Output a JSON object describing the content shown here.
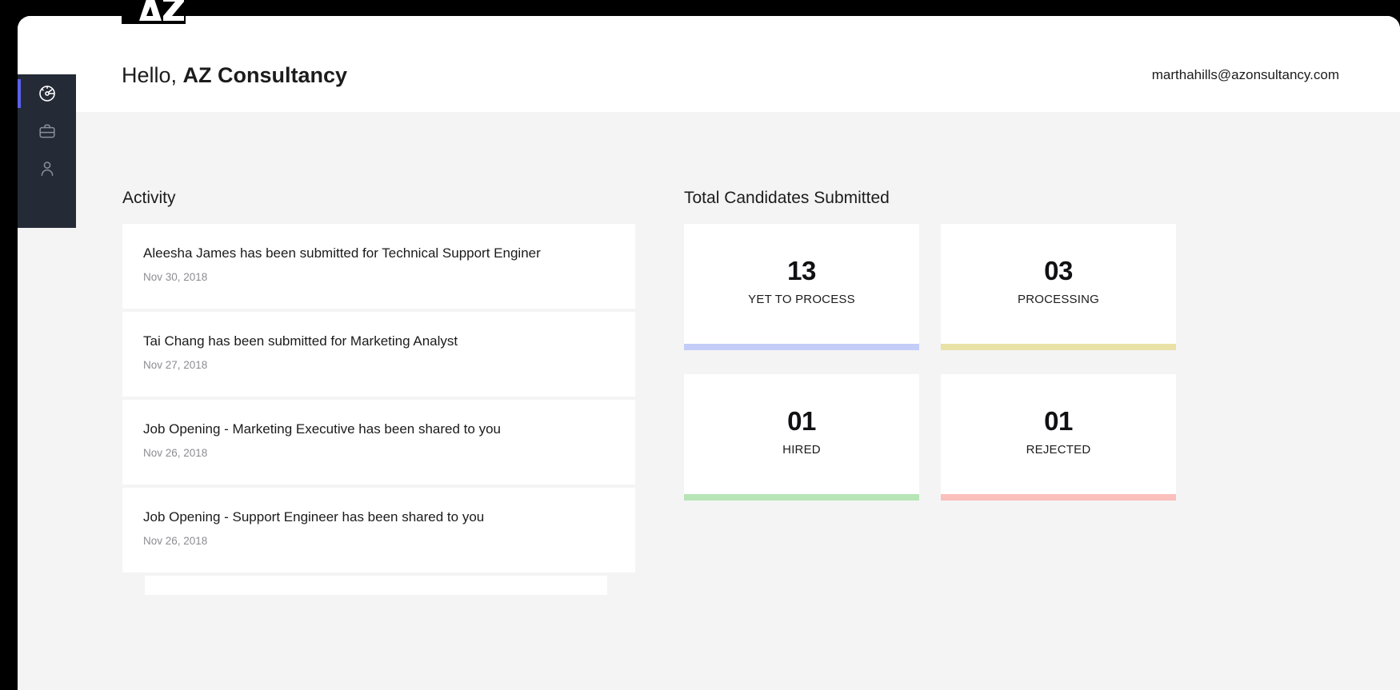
{
  "brand": {
    "logo_text": "AZ",
    "logo_icon": "az-logo-icon"
  },
  "sidebar": {
    "items": [
      {
        "icon": "dashboard-speedometer-icon",
        "name": "dashboard",
        "active": true
      },
      {
        "icon": "briefcase-icon",
        "name": "jobs",
        "active": false
      },
      {
        "icon": "user-person-icon",
        "name": "candidates",
        "active": false
      }
    ],
    "background_color": "#252a37",
    "active_indicator_color": "#5c62ec"
  },
  "header": {
    "greeting_prefix": "Hello, ",
    "company_name": "AZ Consultancy",
    "user_email": "marthahills@azonsultancy.com"
  },
  "activity": {
    "title": "Activity",
    "items": [
      {
        "text": "Aleesha James has been submitted for Technical Support Enginer",
        "date": "Nov 30, 2018"
      },
      {
        "text": "Tai Chang has been submitted for Marketing Analyst",
        "date": "Nov 27, 2018"
      },
      {
        "text": "Job Opening - Marketing Executive has been shared to you",
        "date": "Nov 26, 2018"
      },
      {
        "text": "Job Opening - Support Engineer has been shared to you",
        "date": "Nov 26, 2018"
      }
    ]
  },
  "stats": {
    "title": "Total Candidates Submitted",
    "cards": [
      {
        "value": "13",
        "label": "YET TO PROCESS",
        "bar_color": "#c3cdf8"
      },
      {
        "value": "03",
        "label": "PROCESSING",
        "bar_color": "#e9e1a6"
      },
      {
        "value": "01",
        "label": "HIRED",
        "bar_color": "#b7e5b6"
      },
      {
        "value": "01",
        "label": "REJECTED",
        "bar_color": "#fbbfbc"
      }
    ]
  },
  "theme": {
    "page_background": "#000000",
    "app_background": "#ffffff",
    "content_background": "#f4f4f5",
    "text_primary": "#1c1c1c",
    "text_muted": "#8d8d92"
  }
}
